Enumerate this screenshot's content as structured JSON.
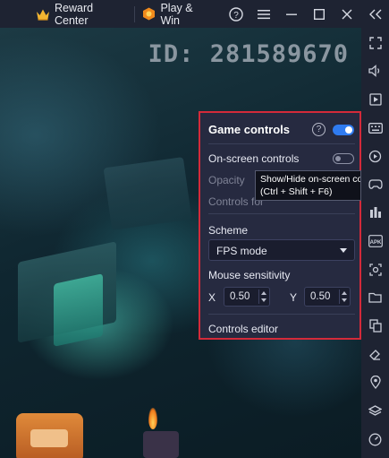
{
  "topbar": {
    "reward_center_label": "Reward Center",
    "play_win_label": "Play & Win",
    "icons": [
      "crown-icon",
      "hexagon-coin-icon",
      "help-icon",
      "menu-icon",
      "minimize-icon",
      "maximize-icon",
      "close-icon",
      "collapse-icon"
    ]
  },
  "game": {
    "id_text": "ID: 281589670"
  },
  "panel": {
    "title": "Game controls",
    "game_controls_enabled": true,
    "on_screen_controls_label": "On-screen controls",
    "on_screen_controls_enabled": false,
    "opacity_label": "Opacity",
    "controls_for_label": "Controls for",
    "scheme_label": "Scheme",
    "scheme_value": "FPS mode",
    "mouse_sensitivity_label": "Mouse sensitivity",
    "x_label": "X",
    "x_value": "0.50",
    "y_label": "Y",
    "y_value": "0.50",
    "controls_editor_label": "Controls editor"
  },
  "tooltip": {
    "line1": "Show/Hide on-screen controls",
    "line2": "(Ctrl + Shift + F6)"
  },
  "sidebar": {
    "icons": [
      "fullscreen-icon",
      "volume-icon",
      "media-icon",
      "keyboard-icon",
      "replay-icon",
      "gamepad-icon",
      "multi-instance-icon",
      "apk-icon",
      "screenshot-icon",
      "folder-icon",
      "copy-icon",
      "eraser-icon",
      "location-icon",
      "layers-icon",
      "speed-icon"
    ]
  },
  "colors": {
    "accent": "#2f7bf0",
    "highlight_border": "#d42a3a",
    "panel_bg": "#262a40",
    "chrome_bg": "#1e2332"
  }
}
